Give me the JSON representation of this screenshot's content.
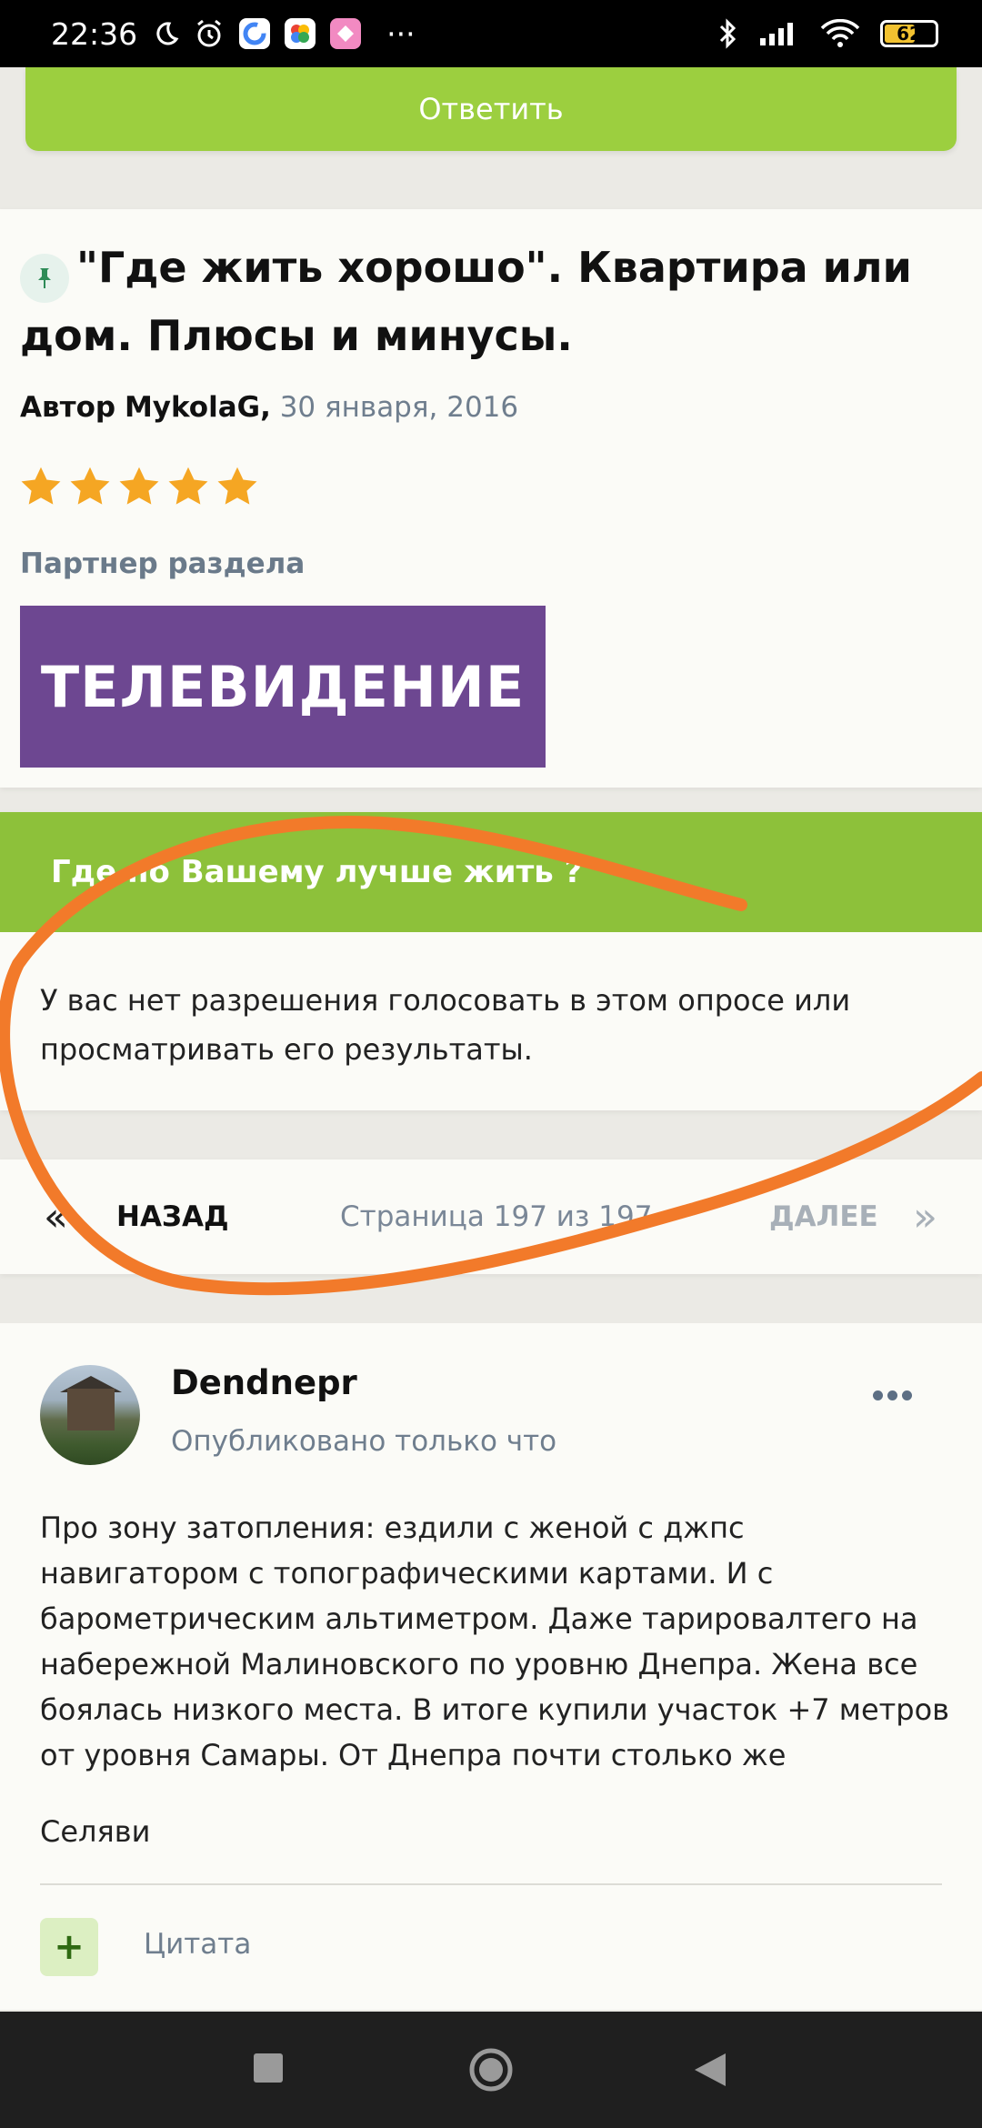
{
  "status_bar": {
    "time": "22:36",
    "battery": "62",
    "more": "···",
    "icons": [
      "moon-icon",
      "alarm-icon",
      "google-app-icon",
      "photos-app-icon",
      "app-icon",
      "bluetooth-icon",
      "signal-icon",
      "wifi-icon",
      "battery-icon"
    ]
  },
  "reply": {
    "label": "Ответить"
  },
  "topic": {
    "title": "\"Где жить хорошо\". Квартира или дом. Плюсы и минусы.",
    "author_prefix": "Автор",
    "author": "MykolaG,",
    "date": "30 января, 2016",
    "rating": 5,
    "partner_label": "Партнер раздела",
    "partner_banner": "ТЕЛЕВИДЕНИЕ",
    "colors": {
      "banner": "#6d4791",
      "stars": "#f5a623"
    }
  },
  "poll": {
    "question": "Где по Вашему лучше жить ?",
    "message": "У вас нет разрешения голосовать в этом опросе или просматривать его результаты."
  },
  "pagination": {
    "prev_arrow": "«",
    "prev": "НАЗАД",
    "info": "Страница 197 из 197",
    "next": "ДАЛЕЕ",
    "next_arrow": "»"
  },
  "post": {
    "author": "Dendnepr",
    "time": "Опубликовано только что",
    "body": "Про зону затопления: ездили с женой с джпс навигатором с топографическими картами. И с барометрическим альтиметром. Даже тарировалтего на набережной Малиновского по уровню Днепра. Жена все боялась низкого места. В итоге купили участок +7 метров от уровня Самары. От Днепра почти столько же",
    "signature": "Селяви",
    "plus": "+",
    "quote": "Цитата"
  },
  "colors": {
    "accent_green": "#9ccf3f",
    "poll_header": "#8dc13a",
    "annotation_orange": "#f27a2a"
  }
}
